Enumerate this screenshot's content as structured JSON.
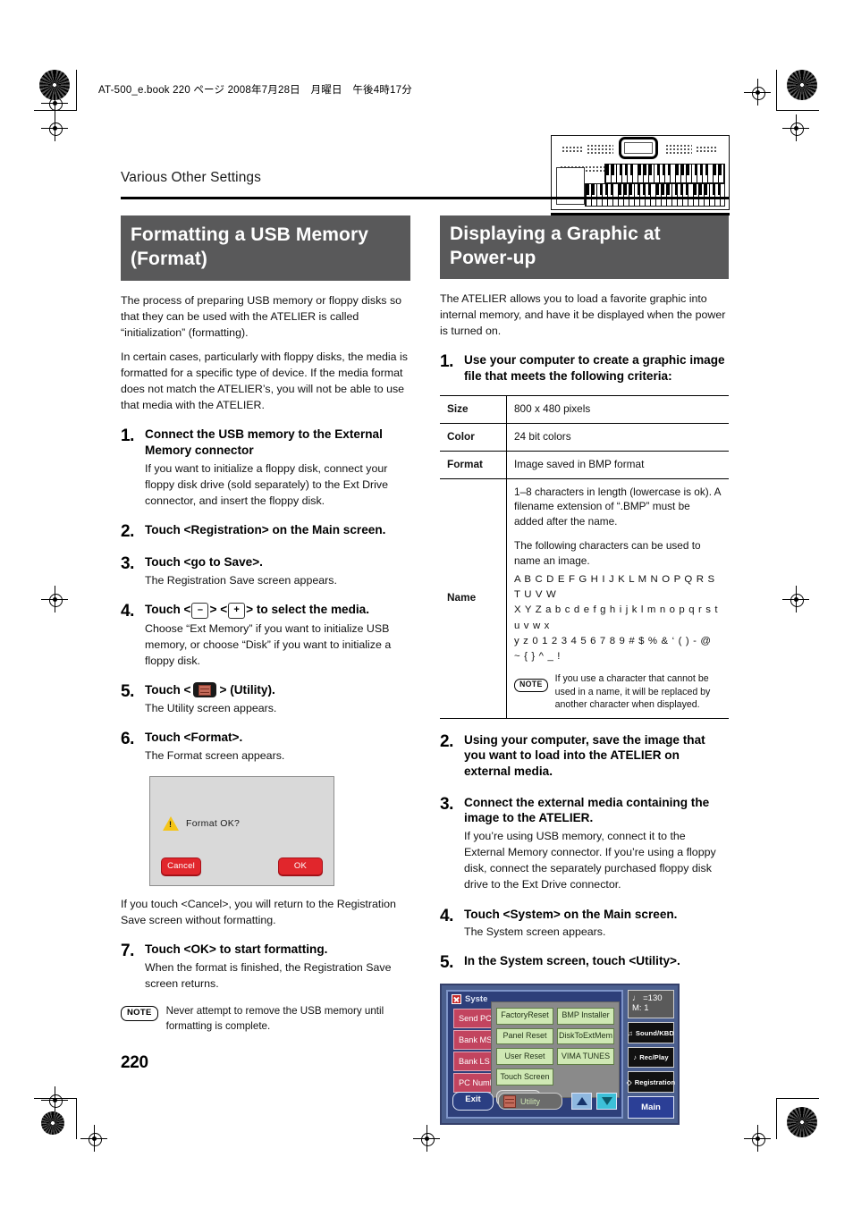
{
  "header": {
    "file_line": "AT-500_e.book 220 ページ 2008年7月28日　月曜日　午後4時17分"
  },
  "breadcrumb": "Various Other Settings",
  "page_number": "220",
  "left_column": {
    "section_title": "Formatting a USB Memory (Format)",
    "intro_p1": "The process of preparing USB memory or floppy disks so that they can be used with the ATELIER is called “initialization” (formatting).",
    "intro_p2": "In certain cases, particularly with floppy disks, the media is formatted for a specific type of device. If the media format does not match the ATELIER’s, you will not be able to use that media with the ATELIER.",
    "steps": [
      {
        "num": "1.",
        "headline": "Connect the USB memory to the External Memory connector",
        "sub": "If you want to initialize a floppy disk, connect your floppy disk drive (sold separately) to the Ext Drive connector, and insert the floppy disk."
      },
      {
        "num": "2.",
        "headline": "Touch <Registration> on the Main screen.",
        "sub": ""
      },
      {
        "num": "3.",
        "headline": "Touch <go to Save>.",
        "sub": "The Registration Save screen appears."
      },
      {
        "num": "4.",
        "headline_pre": "Touch <",
        "key_minus": "–",
        "headline_mid": "> <",
        "key_plus": "+",
        "headline_post": "> to select the media.",
        "sub": "Choose “Ext Memory” if you want to initialize USB memory, or choose “Disk” if you want to initialize a floppy disk."
      },
      {
        "num": "5.",
        "headline_pre": "Touch <",
        "icon": "utility-icon",
        "headline_post": "> (Utility).",
        "sub": "The Utility screen appears."
      },
      {
        "num": "6.",
        "headline": "Touch <Format>.",
        "sub": "The Format screen appears."
      },
      {
        "num": "7.",
        "headline": "Touch <OK> to start formatting.",
        "sub": "When the format is finished, the Registration Save screen returns."
      }
    ],
    "dialog": {
      "message": "Format OK?",
      "cancel_label": "Cancel",
      "ok_label": "OK",
      "warning_icon": "warning-triangle-icon"
    },
    "after_dialog_text": "If you touch <Cancel>, you will return to the Registration Save screen without formatting.",
    "note": {
      "badge": "NOTE",
      "text": "Never attempt to remove the USB memory until formatting is complete."
    }
  },
  "right_column": {
    "section_title": "Displaying a Graphic at Power-up",
    "intro": "The ATELIER allows you to load a favorite graphic into internal memory, and have it be displayed when the power is turned on.",
    "steps": [
      {
        "num": "1.",
        "headline": "Use your computer to create a graphic image file that meets the following criteria:"
      },
      {
        "num": "2.",
        "headline": "Using your computer, save the image that you want to load into the ATELIER on external media."
      },
      {
        "num": "3.",
        "headline": "Connect the external media containing the image to the ATELIER.",
        "sub": "If you’re using USB memory, connect it to the External Memory connector. If you’re using a floppy disk, connect the separately purchased floppy disk drive to the Ext Drive connector."
      },
      {
        "num": "4.",
        "headline": "Touch <System> on the Main screen.",
        "sub": "The System screen appears."
      },
      {
        "num": "5.",
        "headline": "In the System screen, touch <Utility>."
      }
    ],
    "criteria_table": {
      "rows": [
        {
          "label": "Size",
          "value": "800 x 480 pixels"
        },
        {
          "label": "Color",
          "value": "24 bit colors"
        },
        {
          "label": "Format",
          "value": "Image saved in BMP format"
        }
      ],
      "name_row": {
        "label": "Name",
        "line1": "1–8 characters in length (lowercase is ok). A filename extension of “.BMP” must be added after the name.",
        "line2": "The following characters can be used to name an image.",
        "charlist": "A B C D E F G H I J K L M N O P Q R S T U V W\nX Y Z a b c d e f g h i j k l m n o p q r s t u v w x\ny z 0 1 2 3 4 5 6 7 8 9 # $ % & ‘ ( ) - @ ~ { } ^ _ !",
        "note_badge": "NOTE",
        "note_text": "If you use a character that cannot be used in a name, it will be replaced by another character when displayed."
      }
    },
    "lcd": {
      "title": "Syste",
      "left_rows": [
        "Send PC",
        "Bank MS",
        "Bank LS",
        "PC Numb"
      ],
      "popup_buttons": [
        "FactoryReset",
        "BMP Installer",
        "Panel Reset",
        "DiskToExtMem",
        "User Reset",
        "VIMA TUNES",
        "Touch Screen",
        ""
      ],
      "popup_exit": "Exit",
      "bottom_exit": "Exit",
      "bottom_utility": "Utility",
      "tempo_line1": "♩ =130",
      "tempo_line2": "M:      1",
      "side_buttons": [
        "Sound/KBD",
        "Rec/Play",
        "Registration"
      ],
      "main_button": "Main"
    }
  },
  "colors": {
    "section_header_bg": "#59595a",
    "dialog_button_red": "#e1262c",
    "lcd_frame": "#4b5f8e",
    "lcd_screen": "#2e3f7a",
    "lcd_green_button": "#cfe8b4",
    "lcd_red_row": "#c2445f"
  }
}
